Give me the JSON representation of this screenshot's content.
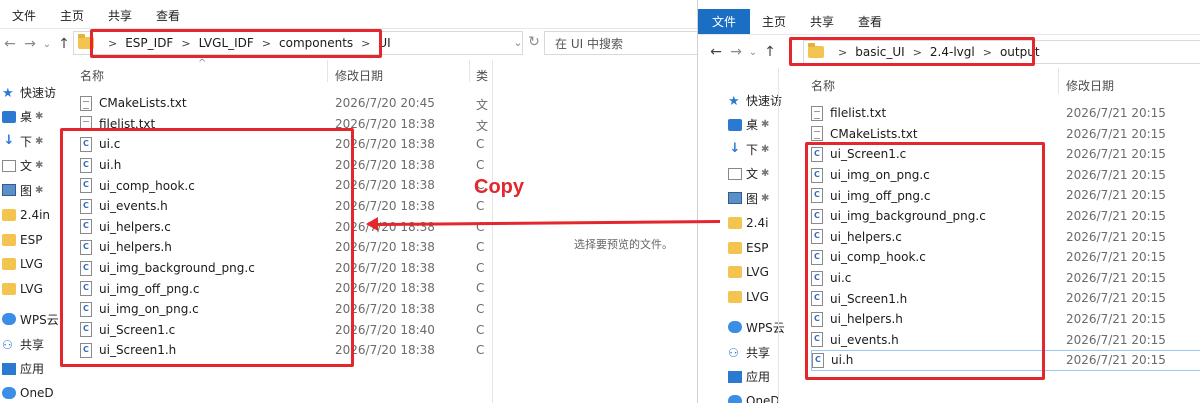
{
  "left": {
    "ribbon": {
      "tabs": [
        "文件",
        "主页",
        "共享",
        "查看"
      ]
    },
    "breadcrumb": [
      "ESP_IDF",
      "LVGL_IDF",
      "components",
      "UI"
    ],
    "search_placeholder": "在 UI 中搜索",
    "columns": {
      "name": "名称",
      "date": "修改日期",
      "type": "类"
    },
    "nav": [
      {
        "label": "快速访",
        "icon": "star-icon"
      },
      {
        "label": "桌",
        "icon": "desktop-icon"
      },
      {
        "label": "下",
        "icon": "download-icon"
      },
      {
        "label": "文",
        "icon": "documents-icon"
      },
      {
        "label": "图",
        "icon": "pictures-icon"
      },
      {
        "label": "2.4in",
        "icon": "folder-icon"
      },
      {
        "label": "ESP",
        "icon": "folder-icon"
      },
      {
        "label": "LVG",
        "icon": "folder-icon"
      },
      {
        "label": "LVG",
        "icon": "folder-icon"
      },
      {
        "label": "WPS云",
        "icon": "cloud-icon"
      },
      {
        "label": "共享",
        "icon": "share-icon"
      },
      {
        "label": "应用",
        "icon": "apps-icon"
      },
      {
        "label": "OneD",
        "icon": "onedrive-icon"
      }
    ],
    "files": [
      {
        "name": "CMakeLists.txt",
        "date": "2026/7/20 20:45",
        "type": "文",
        "kind": "txt"
      },
      {
        "name": "filelist.txt",
        "date": "2026/7/20 18:38",
        "type": "文",
        "kind": "txt"
      },
      {
        "name": "ui.c",
        "date": "2026/7/20 18:38",
        "type": "C",
        "kind": "c"
      },
      {
        "name": "ui.h",
        "date": "2026/7/20 18:38",
        "type": "C",
        "kind": "c"
      },
      {
        "name": "ui_comp_hook.c",
        "date": "2026/7/20 18:38",
        "type": "C",
        "kind": "c"
      },
      {
        "name": "ui_events.h",
        "date": "2026/7/20 18:38",
        "type": "C",
        "kind": "c"
      },
      {
        "name": "ui_helpers.c",
        "date": "2026/7/20 18:38",
        "type": "C",
        "kind": "c"
      },
      {
        "name": "ui_helpers.h",
        "date": "2026/7/20 18:38",
        "type": "C",
        "kind": "c"
      },
      {
        "name": "ui_img_background_png.c",
        "date": "2026/7/20 18:38",
        "type": "C",
        "kind": "c"
      },
      {
        "name": "ui_img_off_png.c",
        "date": "2026/7/20 18:38",
        "type": "C",
        "kind": "c"
      },
      {
        "name": "ui_img_on_png.c",
        "date": "2026/7/20 18:38",
        "type": "C",
        "kind": "c"
      },
      {
        "name": "ui_Screen1.c",
        "date": "2026/7/20 18:40",
        "type": "C",
        "kind": "c"
      },
      {
        "name": "ui_Screen1.h",
        "date": "2026/7/20 18:38",
        "type": "C",
        "kind": "c"
      }
    ],
    "preview_text": "选择要预览的文件。"
  },
  "right": {
    "ribbon": {
      "tabs": [
        "文件",
        "主页",
        "共享",
        "查看"
      ]
    },
    "breadcrumb": [
      "basic_UI",
      "2.4-lvgl",
      "output"
    ],
    "columns": {
      "name": "名称",
      "date": "修改日期"
    },
    "nav": [
      {
        "label": "快速访",
        "icon": "star-icon"
      },
      {
        "label": "桌",
        "icon": "desktop-icon"
      },
      {
        "label": "下",
        "icon": "download-icon"
      },
      {
        "label": "文",
        "icon": "documents-icon"
      },
      {
        "label": "图",
        "icon": "pictures-icon"
      },
      {
        "label": "2.4i",
        "icon": "folder-icon"
      },
      {
        "label": "ESP",
        "icon": "folder-icon"
      },
      {
        "label": "LVG",
        "icon": "folder-icon"
      },
      {
        "label": "LVG",
        "icon": "folder-icon"
      },
      {
        "label": "WPS云",
        "icon": "cloud-icon"
      },
      {
        "label": "共享",
        "icon": "share-icon"
      },
      {
        "label": "应用",
        "icon": "apps-icon"
      },
      {
        "label": "OneD",
        "icon": "onedrive-icon"
      }
    ],
    "files": [
      {
        "name": "filelist.txt",
        "date": "2026/7/21 20:15",
        "kind": "txt"
      },
      {
        "name": "CMakeLists.txt",
        "date": "2026/7/21 20:15",
        "kind": "txt"
      },
      {
        "name": "ui_Screen1.c",
        "date": "2026/7/21 20:15",
        "kind": "c"
      },
      {
        "name": "ui_img_on_png.c",
        "date": "2026/7/21 20:15",
        "kind": "c"
      },
      {
        "name": "ui_img_off_png.c",
        "date": "2026/7/21 20:15",
        "kind": "c"
      },
      {
        "name": "ui_img_background_png.c",
        "date": "2026/7/21 20:15",
        "kind": "c"
      },
      {
        "name": "ui_helpers.c",
        "date": "2026/7/21 20:15",
        "kind": "c"
      },
      {
        "name": "ui_comp_hook.c",
        "date": "2026/7/21 20:15",
        "kind": "c"
      },
      {
        "name": "ui.c",
        "date": "2026/7/21 20:15",
        "kind": "c"
      },
      {
        "name": "ui_Screen1.h",
        "date": "2026/7/21 20:15",
        "kind": "c"
      },
      {
        "name": "ui_helpers.h",
        "date": "2026/7/21 20:15",
        "kind": "c"
      },
      {
        "name": "ui_events.h",
        "date": "2026/7/21 20:15",
        "kind": "c"
      },
      {
        "name": "ui.h",
        "date": "2026/7/21 20:15",
        "kind": "c"
      }
    ]
  },
  "annotation": {
    "copy_label": "Copy"
  },
  "colors": {
    "highlight_red": "#e3272d",
    "accent_blue": "#1a6fc4",
    "folder_yellow": "#f3c550"
  }
}
